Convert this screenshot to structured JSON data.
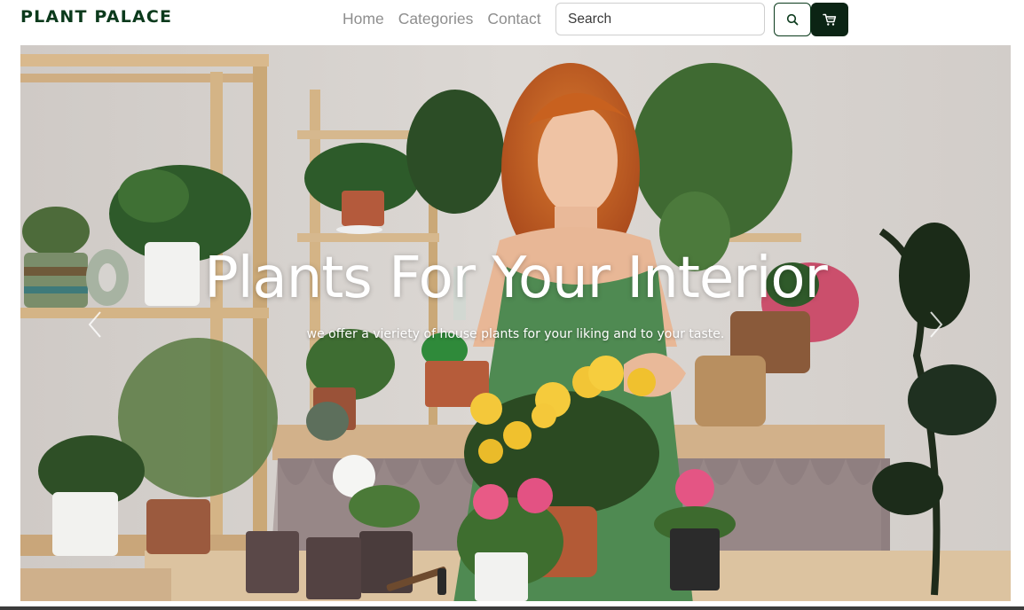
{
  "brand": {
    "name": "PLANT PALACE"
  },
  "nav": {
    "links": [
      {
        "label": "Home"
      },
      {
        "label": "Categories"
      },
      {
        "label": "Contact"
      }
    ]
  },
  "search": {
    "placeholder": "Search",
    "value": ""
  },
  "icons": {
    "search": "search-icon",
    "cart": "cart-icon",
    "prev": "chevron-left-icon",
    "next": "chevron-right-icon"
  },
  "colors": {
    "brand": "#0b3a1c",
    "cart_button": "#0b2414",
    "nav_link": "#8e8e8e"
  },
  "hero": {
    "title": "Plants For Your Interior",
    "subtitle": "we offer a vieriety of house plants for your liking and to your taste."
  }
}
